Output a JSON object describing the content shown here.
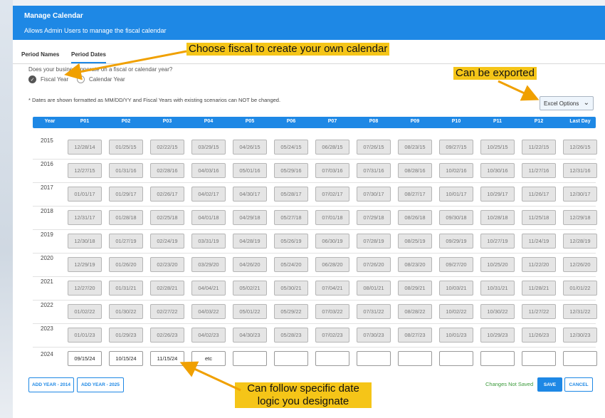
{
  "header": {
    "title": "Manage Calendar",
    "subtitle": "Allows Admin Users to manage the fiscal calendar"
  },
  "tabs": [
    {
      "label": "Period Names",
      "active": false
    },
    {
      "label": "Period Dates",
      "active": true
    }
  ],
  "question": "Does your business operate on a fiscal or calendar year?",
  "radios": [
    {
      "label": "Fiscal Year",
      "checked": true
    },
    {
      "label": "Calendar Year",
      "checked": false
    }
  ],
  "note": "* Dates are shown formatted as MM/DD/YY and Fiscal Years with existing scenarios can NOT be changed.",
  "export": {
    "label": "Excel Options"
  },
  "columns": [
    "Year",
    "P01",
    "P02",
    "P03",
    "P04",
    "P05",
    "P06",
    "P07",
    "P08",
    "P09",
    "P10",
    "P11",
    "P12",
    "Last Day"
  ],
  "rows": [
    {
      "year": "2015",
      "dates": [
        "12/28/14",
        "01/25/15",
        "02/22/15",
        "03/29/15",
        "04/26/15",
        "05/24/15",
        "06/28/15",
        "07/26/15",
        "08/23/15",
        "09/27/15",
        "10/25/15",
        "11/22/15",
        "12/26/15"
      ],
      "editable": false
    },
    {
      "year": "2016",
      "dates": [
        "12/27/15",
        "01/31/16",
        "02/28/16",
        "04/03/16",
        "05/01/16",
        "05/29/16",
        "07/03/16",
        "07/31/16",
        "08/28/16",
        "10/02/16",
        "10/30/16",
        "11/27/16",
        "12/31/16"
      ],
      "editable": false
    },
    {
      "year": "2017",
      "dates": [
        "01/01/17",
        "01/29/17",
        "02/26/17",
        "04/02/17",
        "04/30/17",
        "05/28/17",
        "07/02/17",
        "07/30/17",
        "08/27/17",
        "10/01/17",
        "10/29/17",
        "11/26/17",
        "12/30/17"
      ],
      "editable": false
    },
    {
      "year": "2018",
      "dates": [
        "12/31/17",
        "01/28/18",
        "02/25/18",
        "04/01/18",
        "04/29/18",
        "05/27/18",
        "07/01/18",
        "07/29/18",
        "08/26/18",
        "09/30/18",
        "10/28/18",
        "11/25/18",
        "12/29/18"
      ],
      "editable": false
    },
    {
      "year": "2019",
      "dates": [
        "12/30/18",
        "01/27/19",
        "02/24/19",
        "03/31/19",
        "04/28/19",
        "05/26/19",
        "06/30/19",
        "07/28/19",
        "08/25/19",
        "09/29/19",
        "10/27/19",
        "11/24/19",
        "12/28/19"
      ],
      "editable": false
    },
    {
      "year": "2020",
      "dates": [
        "12/29/19",
        "01/26/20",
        "02/23/20",
        "03/29/20",
        "04/26/20",
        "05/24/20",
        "06/28/20",
        "07/26/20",
        "08/23/20",
        "09/27/20",
        "10/25/20",
        "11/22/20",
        "12/26/20"
      ],
      "editable": false
    },
    {
      "year": "2021",
      "dates": [
        "12/27/20",
        "01/31/21",
        "02/28/21",
        "04/04/21",
        "05/02/21",
        "05/30/21",
        "07/04/21",
        "08/01/21",
        "08/29/21",
        "10/03/21",
        "10/31/21",
        "11/28/21",
        "01/01/22"
      ],
      "editable": false
    },
    {
      "year": "2022",
      "dates": [
        "01/02/22",
        "01/30/22",
        "02/27/22",
        "04/03/22",
        "05/01/22",
        "05/29/22",
        "07/03/22",
        "07/31/22",
        "08/28/22",
        "10/02/22",
        "10/30/22",
        "11/27/22",
        "12/31/22"
      ],
      "editable": false
    },
    {
      "year": "2023",
      "dates": [
        "01/01/23",
        "01/29/23",
        "02/26/23",
        "04/02/23",
        "04/30/23",
        "05/28/23",
        "07/02/23",
        "07/30/23",
        "08/27/23",
        "10/01/23",
        "10/29/23",
        "11/26/23",
        "12/30/23"
      ],
      "editable": false
    },
    {
      "year": "2024",
      "dates": [
        "09/15/24",
        "10/15/24",
        "11/15/24",
        "etc",
        "",
        "",
        "",
        "",
        "",
        "",
        "",
        "",
        ""
      ],
      "editable": true
    }
  ],
  "footer": {
    "add_prev": "ADD YEAR - 2014",
    "add_next": "ADD YEAR - 2025",
    "status": "Changes Not Saved",
    "save": "SAVE",
    "cancel": "CANCEL"
  },
  "callouts": {
    "fiscal": "Choose fiscal to create your own calendar",
    "export": "Can be exported",
    "logic": "Can follow specific date logic you designate"
  },
  "colors": {
    "accent": "#1e88e5",
    "callout": "#f5c518",
    "arrow": "#f0a000",
    "status": "#3a9a3a"
  },
  "icons": {
    "checked_radio": "check-circle-icon",
    "dropdown": "chevron-down-icon"
  }
}
